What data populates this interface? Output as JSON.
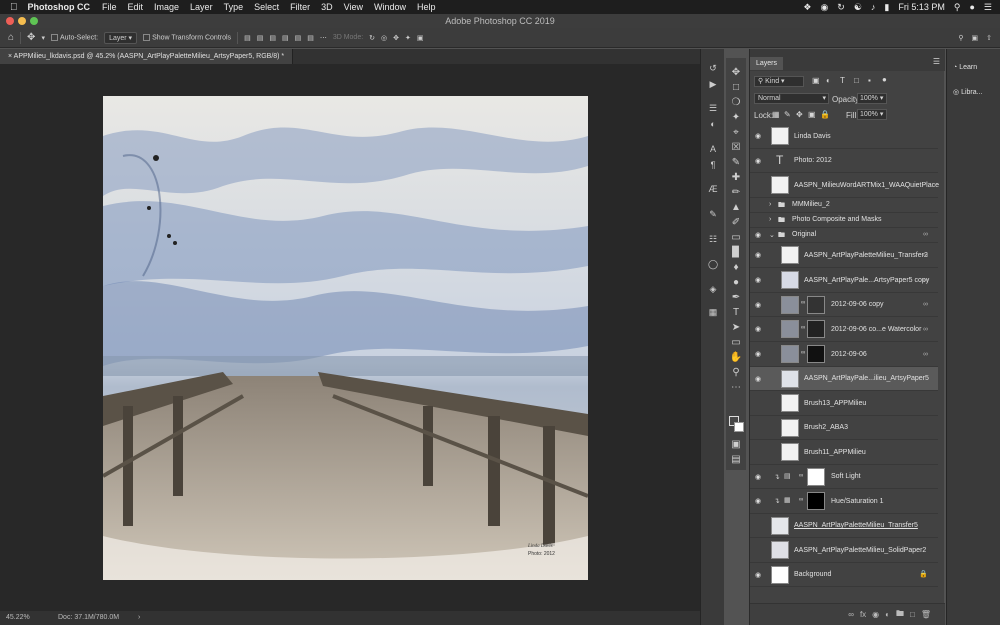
{
  "menubar": {
    "apple": "",
    "app_name": "Photoshop CC",
    "menus": [
      "File",
      "Edit",
      "Image",
      "Layer",
      "Type",
      "Select",
      "Filter",
      "3D",
      "View",
      "Window",
      "Help"
    ],
    "clock": "Fri 5:13 PM"
  },
  "window": {
    "title": "Adobe Photoshop CC 2019"
  },
  "options_bar": {
    "auto_select_label": "Auto-Select:",
    "auto_select_value": "Layer",
    "show_transform_label": "Show Transform Controls",
    "mode_3d_label": "3D Mode:"
  },
  "document": {
    "tab_title": "APPMilieu_lkdavis.psd @ 45.2% (AASPN_ArtPlayPaletteMilieu_ArtsyPaper5, RGB/8) *",
    "signature": "Linda Davis",
    "signature_year": "Photo: 2012"
  },
  "status": {
    "zoom": "45.22%",
    "doc_info": "Doc: 37.1M/780.0M"
  },
  "layers_panel": {
    "tab": "Layers",
    "kind_filter": "Kind",
    "blend_mode": "Normal",
    "opacity_label": "Opacity:",
    "opacity_value": "100%",
    "lock_label": "Lock:",
    "fill_label": "Fill:",
    "fill_value": "100%",
    "layers": [
      {
        "name": "Linda Davis",
        "visible": true
      },
      {
        "name": "Photo: 2012",
        "visible": true
      },
      {
        "name": "AASPN_MilieuWordARTMix1_WAAQuietPlace",
        "visible": false
      },
      {
        "name": "MMMilieu_2",
        "visible": false
      },
      {
        "name": "Photo Composite and Masks",
        "visible": false
      },
      {
        "name": "Original",
        "visible": true
      },
      {
        "name": "AASPN_ArtPlayPaletteMilieu_Transfer2",
        "visible": true
      },
      {
        "name": "AASPN_ArtPlayPale...ArtsyPaper5 copy",
        "visible": true
      },
      {
        "name": "2012-09-06 copy",
        "visible": true
      },
      {
        "name": "2012-09-06 co...e Watercolor",
        "visible": true
      },
      {
        "name": "2012-09-06",
        "visible": true
      },
      {
        "name": "AASPN_ArtPlayPale...ilieu_ArtsyPaper5",
        "visible": true
      },
      {
        "name": "Brush13_APPMilieu",
        "visible": false
      },
      {
        "name": "Brush2_ABA3",
        "visible": false
      },
      {
        "name": "Brush11_APPMilieu",
        "visible": false
      },
      {
        "name": "Soft Light",
        "visible": true
      },
      {
        "name": "Hue/Saturation 1",
        "visible": true
      },
      {
        "name": "AASPN_ArtPlayPaletteMilieu_Transfer5",
        "visible": false
      },
      {
        "name": "AASPN_ArtPlayPaletteMilieu_SolidPaper2",
        "visible": false
      },
      {
        "name": "Background",
        "visible": true
      }
    ]
  },
  "right_panel": {
    "learn": "Learn",
    "libraries": "Libra..."
  }
}
